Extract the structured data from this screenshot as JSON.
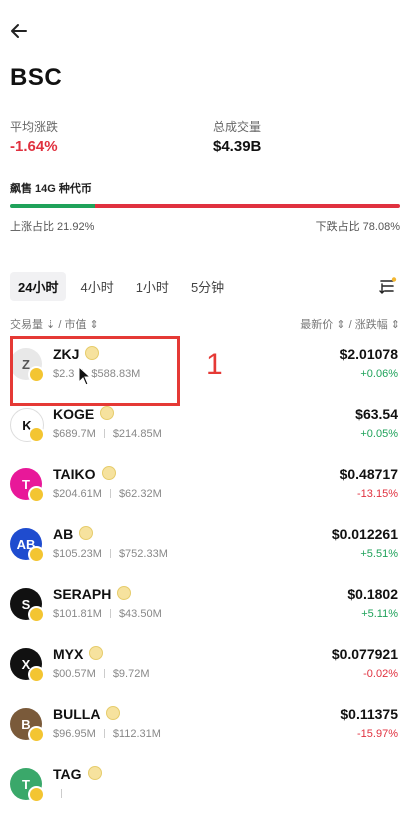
{
  "header": {
    "title": "BSC"
  },
  "stats": {
    "avg_change_label": "平均涨跌",
    "avg_change_value": "-1.64%",
    "total_volume_label": "总成交量",
    "total_volume_value": "$4.39B"
  },
  "section": {
    "title": "飙售 14G 种代币",
    "up_label": "上涨占比 21.92%",
    "down_label": "下跌占比 78.08%",
    "up_ratio": 0.2192
  },
  "tabs": [
    "24小时",
    "4小时",
    "1小时",
    "5分钟"
  ],
  "active_tab": 0,
  "columns": {
    "left": "交易量 ⇣ / 市值 ⇕",
    "right": "最新价 ⇕ / 涨跌幅 ⇕"
  },
  "tokens": [
    {
      "symbol": "ZKJ",
      "volume": "$2.3",
      "mcap": "$588.83M",
      "price": "$2.01078",
      "change": "+0.06%",
      "dir": "up",
      "logo_bg": "#e8e8e8",
      "logo_fg": "#555",
      "logo_text": "Z"
    },
    {
      "symbol": "KOGE",
      "volume": "$689.7M",
      "mcap": "$214.85M",
      "price": "$63.54",
      "change": "+0.05%",
      "dir": "up",
      "logo_bg": "#ffffff",
      "logo_fg": "#111",
      "logo_text": "K"
    },
    {
      "symbol": "TAIKO",
      "volume": "$204.61M",
      "mcap": "$62.32M",
      "price": "$0.48717",
      "change": "-13.15%",
      "dir": "down",
      "logo_bg": "#e81899",
      "logo_fg": "#fff",
      "logo_text": "T"
    },
    {
      "symbol": "AB",
      "volume": "$105.23M",
      "mcap": "$752.33M",
      "price": "$0.012261",
      "change": "+5.51%",
      "dir": "up",
      "logo_bg": "#1f4ccf",
      "logo_fg": "#fff",
      "logo_text": "AB"
    },
    {
      "symbol": "SERAPH",
      "volume": "$101.81M",
      "mcap": "$43.50M",
      "price": "$0.1802",
      "change": "+5.11%",
      "dir": "up",
      "logo_bg": "#111111",
      "logo_fg": "#fff",
      "logo_text": "S"
    },
    {
      "symbol": "MYX",
      "volume": "$00.57M",
      "mcap": "$9.72M",
      "price": "$0.077921",
      "change": "-0.02%",
      "dir": "down",
      "logo_bg": "#111111",
      "logo_fg": "#fff",
      "logo_text": "X"
    },
    {
      "symbol": "BULLA",
      "volume": "$96.95M",
      "mcap": "$112.31M",
      "price": "$0.11375",
      "change": "-15.97%",
      "dir": "down",
      "logo_bg": "#7a5a3a",
      "logo_fg": "#fff",
      "logo_text": "B"
    },
    {
      "symbol": "TAG",
      "volume": "",
      "mcap": "",
      "price": "",
      "change": "",
      "dir": "up",
      "logo_bg": "#3aa86a",
      "logo_fg": "#fff",
      "logo_text": "T"
    }
  ],
  "annotation": {
    "number": "1"
  },
  "colors": {
    "up": "#1fa25a",
    "down": "#e0313f",
    "highlight": "#e53935"
  }
}
